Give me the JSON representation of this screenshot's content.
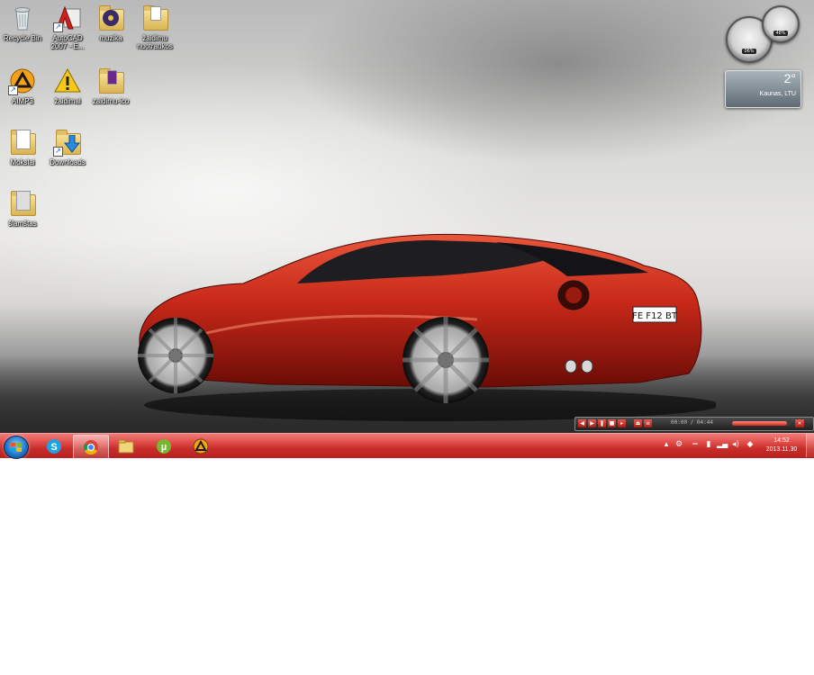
{
  "desktop": {
    "icons": [
      {
        "label": "Recycle Bin"
      },
      {
        "label": "AutoCAD 2007 - E..."
      },
      {
        "label": "muzika"
      },
      {
        "label": "žaidimu nuotraukos"
      },
      {
        "label": "AIMP3"
      },
      {
        "label": "žaidimai"
      },
      {
        "label": "zaidimu-ico"
      },
      {
        "label": "Mokslai"
      },
      {
        "label": "Downloads"
      },
      {
        "label": "šlamštas"
      }
    ]
  },
  "car": {
    "plate": "FE F12 BT"
  },
  "gadgets": {
    "cpu_meter": {
      "cpu": "06%",
      "ram": "48%"
    },
    "weather": {
      "temperature": "2°",
      "location": "Kaunas, LTU"
    }
  },
  "media_bar": {
    "time": "00:00 / 04:44",
    "progress": 0.92
  },
  "taskbar": {
    "pinned": [
      {
        "name": "Skype",
        "icon": "skype-icon"
      },
      {
        "name": "Google Chrome",
        "icon": "chrome-icon",
        "active": true
      },
      {
        "name": "Windows Explorer",
        "icon": "folder-icon"
      },
      {
        "name": "uTorrent",
        "icon": "utorrent-icon"
      },
      {
        "name": "AIMP3",
        "icon": "aimp-icon"
      }
    ],
    "clock": {
      "time": "14:52",
      "date": "2013.11.30"
    }
  },
  "colors": {
    "taskbar": "#c8302c",
    "accent": "#d22a1a"
  }
}
